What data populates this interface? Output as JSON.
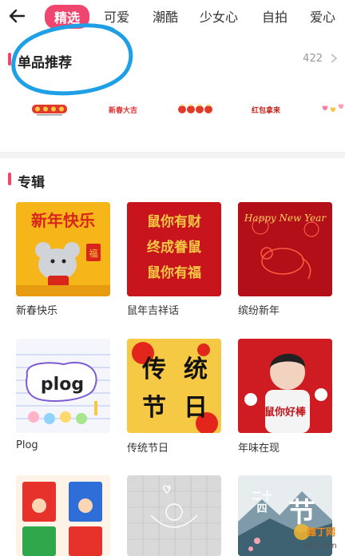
{
  "nav": {
    "tabs": [
      {
        "label": "精选",
        "active": true
      },
      {
        "label": "可爱"
      },
      {
        "label": "潮酷"
      },
      {
        "label": "少女心"
      },
      {
        "label": "自拍"
      },
      {
        "label": "爱心"
      }
    ]
  },
  "singles": {
    "title": "单品推荐",
    "count": "422",
    "stickers": [
      "新春快乐",
      "新春大吉",
      "福福福",
      "红包拿来",
      "爱心"
    ]
  },
  "album": {
    "title": "专辑",
    "cards": [
      {
        "label": "新春快乐",
        "art": "新年快乐"
      },
      {
        "label": "鼠年吉祥话",
        "art": "鼠你有财 终成眷鼠 鼠你有福"
      },
      {
        "label": "缤纷新年",
        "art": "Happy New Year"
      },
      {
        "label": "Plog",
        "art": "plog"
      },
      {
        "label": "传统节日",
        "art": "传统节日"
      },
      {
        "label": "年味在现",
        "art": "鼠你好棒"
      },
      {
        "label": "",
        "art": ""
      },
      {
        "label": "",
        "art": ""
      },
      {
        "label": "",
        "art": "二十四节气"
      }
    ]
  },
  "watermark": {
    "text": "趣丁网",
    "url": "q2d.com"
  },
  "colors": {
    "accent": "#f0456e",
    "annotation": "#1fa0e6"
  }
}
